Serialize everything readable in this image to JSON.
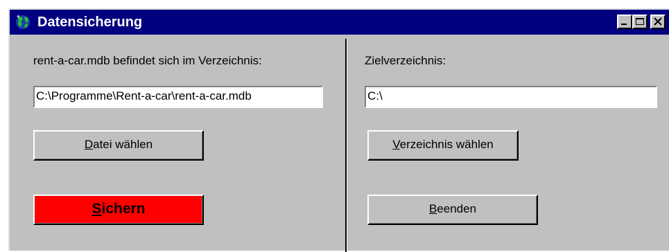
{
  "window": {
    "title": "Datensicherung",
    "icon": "globe-icon",
    "controls": [
      "minimize-icon",
      "maximize-icon",
      "close-icon"
    ]
  },
  "source": {
    "label": "rent-a-car.mdb befindet sich im Verzeichnis:",
    "path_value": "C:\\Programme\\Rent-a-car\\rent-a-car.mdb",
    "choose_button": {
      "mnemonic": "D",
      "rest": "atei wählen"
    }
  },
  "target": {
    "label": "Zielverzeichnis:",
    "path_value": "C:\\",
    "choose_button": {
      "mnemonic": "V",
      "rest": "erzeichnis wählen"
    }
  },
  "actions": {
    "save_button": {
      "mnemonic": "S",
      "rest": "ichern",
      "color": "#ff0000"
    },
    "exit_button": {
      "mnemonic": "B",
      "rest": "eenden"
    }
  },
  "colors": {
    "titlebar": "#000080",
    "face": "#c0c0c0",
    "save_accent": "#ff0000"
  }
}
